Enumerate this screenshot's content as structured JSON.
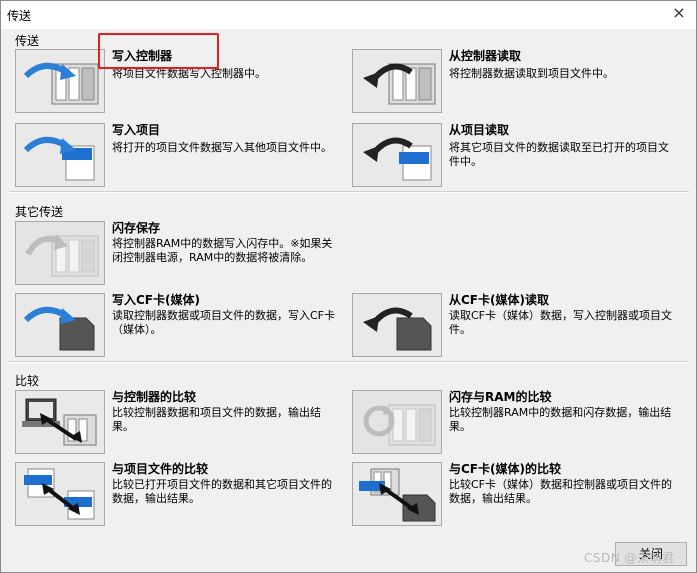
{
  "window": {
    "title": "传送",
    "close_glyph": "×"
  },
  "groups": [
    {
      "label": "传送",
      "items": [
        {
          "title": "写入控制器",
          "desc": "将项目文件数据写入控制器中。",
          "icon": "write-to-controller-icon"
        },
        {
          "title": "从控制器读取",
          "desc": "将控制器数据读取到项目文件中。",
          "icon": "read-from-controller-icon"
        },
        {
          "title": "写入项目",
          "desc": "将打开的项目文件数据写入其他项目文件中。",
          "icon": "write-to-project-icon"
        },
        {
          "title": "从项目读取",
          "desc": "将其它项目文件的数据读取至已打开的项目文件中。",
          "icon": "read-from-project-icon"
        }
      ]
    },
    {
      "label": "其它传送",
      "items": [
        {
          "title": "闪存保存",
          "desc": "将控制器RAM中的数据写入闪存中。※如果关闭控制器电源，RAM中的数据将被清除。",
          "icon": "flash-save-icon"
        },
        {
          "title": "写入CF卡(媒体)",
          "desc": "读取控制器数据或项目文件的数据，写入CF卡（媒体）。",
          "icon": "write-cf-card-icon"
        },
        {
          "title": "从CF卡(媒体)读取",
          "desc": "读取CF卡（媒体）数据，写入控制器或项目文件。",
          "icon": "read-cf-card-icon"
        }
      ]
    },
    {
      "label": "比较",
      "items": [
        {
          "title": "与控制器的比较",
          "desc": "比较控制器数据和项目文件的数据，输出结果。",
          "icon": "compare-controller-icon"
        },
        {
          "title": "闪存与RAM的比较",
          "desc": "比较控制器RAM中的数据和闪存数据，输出结果。",
          "icon": "compare-flash-ram-icon"
        },
        {
          "title": "与项目文件的比较",
          "desc": "比较已打开项目文件的数据和其它项目文件的数据，输出结果。",
          "icon": "compare-project-icon"
        },
        {
          "title": "与CF卡(媒体)的比较",
          "desc": "比较CF卡（媒体）数据和控制器或项目文件的数据，输出结果。",
          "icon": "compare-cf-card-icon"
        }
      ]
    }
  ],
  "buttons": {
    "close": "关闭"
  },
  "watermark": "CSDN @未萌君",
  "colors": {
    "arrow_blue": "#2b7fd6",
    "highlight": "#e02020",
    "card_dark": "#555555"
  }
}
